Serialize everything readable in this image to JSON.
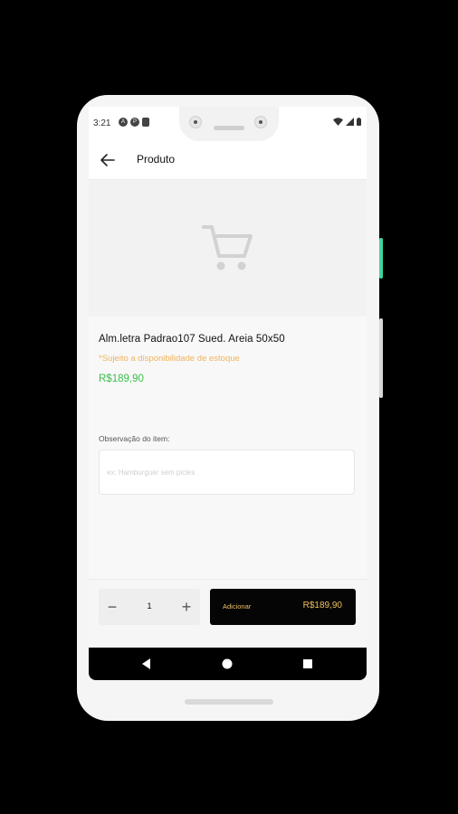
{
  "status_bar": {
    "time": "3:21",
    "left_icons": [
      "a-icon",
      "p-icon",
      "sim-icon"
    ],
    "right_icons": [
      "wifi-icon",
      "signal-icon",
      "battery-icon"
    ]
  },
  "app_bar": {
    "back_icon": "arrow-left-icon",
    "title": "Produto"
  },
  "product": {
    "image_placeholder_icon": "shopping-cart-icon",
    "name": "Alm.letra Padrao107 Sued. Areia 50x50",
    "stock_note": "*Sujeito a disponibilidade de estoque",
    "price": "R$189,90"
  },
  "observation": {
    "label": "Observação do item:",
    "placeholder": "ex: Hamburguer sem picles",
    "value": ""
  },
  "bottom_bar": {
    "minus_label": "−",
    "quantity": "1",
    "plus_label": "+",
    "add_button_label": "Adicionar",
    "add_button_price": "R$189,90"
  },
  "nav_bar": {
    "buttons": [
      "back-triangle-icon",
      "home-circle-icon",
      "recents-square-icon"
    ]
  },
  "colors": {
    "price_green": "#3bbf4a",
    "stock_note_orange": "#f0b35a",
    "button_black": "#050505",
    "button_text_gold": "#f0c060",
    "side_button_accent": "#3dd6a0"
  }
}
